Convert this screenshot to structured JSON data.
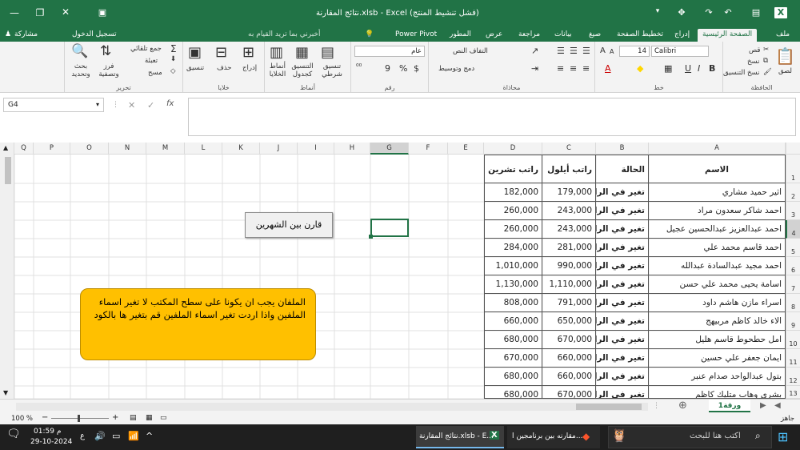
{
  "title": "نتائج المقارنة.xlsb - Excel (فشل تنشيط المنتج)",
  "title_buttons": {
    "minimize": "—",
    "restore": "❐",
    "close": "✕"
  },
  "user_menu": {
    "share": "مشاركة",
    "signin": "تسجيل الدخول",
    "tell_me": "أخبرني بما تريد القيام به"
  },
  "tabs": [
    "ملف",
    "الصفحة الرئيسية",
    "إدراج",
    "تخطيط الصفحة",
    "صيغ",
    "بيانات",
    "مراجعة",
    "عرض",
    "المطور",
    "Power Pivot"
  ],
  "ribbon": {
    "clipboard": {
      "paste": "لصق",
      "cut": "قص",
      "copy": "نسخ",
      "format_painter": "نسخ التنسيق",
      "label": "الحافظة"
    },
    "font": {
      "name": "Calibri",
      "size": "14",
      "label": "خط",
      "bold": "B",
      "italic": "I",
      "underline": "U",
      "grow": "A",
      "shrink": "A"
    },
    "alignment": {
      "wrap": "التفاف النص",
      "merge": "دمج وتوسيط",
      "label": "محاذاة"
    },
    "number": {
      "format": "عام",
      "label": "رقم",
      "percent": "%",
      "comma": "9"
    },
    "styles": {
      "conditional": "تنسيق شرطي",
      "as_table": "التنسيق كجدول",
      "cell_styles": "أنماط الخلايا",
      "label": "أنماط"
    },
    "cells": {
      "insert": "إدراج",
      "delete": "حذف",
      "format": "تنسيق",
      "label": "خلايا"
    },
    "editing": {
      "autosum": "جمع تلقائي",
      "fill": "تعبئة",
      "clear": "مسح",
      "sort": "فرز وتصفية",
      "find": "بحث وتحديد",
      "label": "تحرير"
    }
  },
  "namebox": "G4",
  "fx": "fx",
  "columns": [
    "A",
    "B",
    "C",
    "D",
    "E",
    "F",
    "G",
    "H",
    "I",
    "J",
    "K",
    "L",
    "M",
    "N",
    "O",
    "P",
    "Q"
  ],
  "rows": [
    "1",
    "2",
    "3",
    "4",
    "5",
    "6",
    "7",
    "8",
    "9",
    "10",
    "11",
    "12",
    "13"
  ],
  "table": {
    "headers": [
      "الاسم",
      "الحالة",
      "راتب أيلول",
      "راتب تشرين الأول"
    ],
    "data": [
      [
        "اثير حميد مشاري",
        "تغير في الراتب",
        "179,000",
        "182,000"
      ],
      [
        "احمد شاكر سعدون مراد",
        "تغير في الراتب",
        "243,000",
        "260,000"
      ],
      [
        "احمد عبدالعزيز عبدالحسين عجيل",
        "تغير في الراتب",
        "243,000",
        "260,000"
      ],
      [
        "احمد قاسم محمد علي",
        "تغير في الراتب",
        "281,000",
        "284,000"
      ],
      [
        "احمد مجيد عبدالسادة عبدالله",
        "تغير في الراتب",
        "990,000",
        "1,010,000"
      ],
      [
        "اسامة يحيى محمد علي حسن",
        "تغير في الراتب",
        "1,110,000",
        "1,130,000"
      ],
      [
        "اسراء مازن هاشم داود",
        "تغير في الراتب",
        "791,000",
        "808,000"
      ],
      [
        "الاء خالد كاظم مربيهج",
        "تغير في الراتب",
        "650,000",
        "660,000"
      ],
      [
        "امل حطحوط قاسم هليل",
        "تغير في الراتب",
        "670,000",
        "680,000"
      ],
      [
        "ايمان جعفر علي حسين",
        "تغير في الراتب",
        "660,000",
        "670,000"
      ],
      [
        "بتول عبدالواحد صدام عنبر",
        "تغير في الراتب",
        "660,000",
        "680,000"
      ],
      [
        "بشرى وهاب متليك كاظم",
        "تغير في الراتب",
        "670,000",
        "680,000"
      ]
    ]
  },
  "compare_button": "قارن بين الشهرين",
  "note": "الملفان يجب ان يكونا على سطح المكتب   لا تغير اسماء الملفين واذا اردت تغير اسماء الملفين قم بتغير ها بالكود",
  "sheet_tab": "ورقة1",
  "status": {
    "ready": "جاهز",
    "zoom": "100 %"
  },
  "taskbar": {
    "search": "اكتب هنا للبحث",
    "app1": "مقارنه بين برنامجين ا...",
    "app2": "نتائج المقارنة.xlsb - E...",
    "time": "01:59 م",
    "date": "29-10-2024",
    "lang": "ع"
  },
  "colors": {
    "excel_green": "#217346",
    "note_fill": "#ffc000"
  }
}
